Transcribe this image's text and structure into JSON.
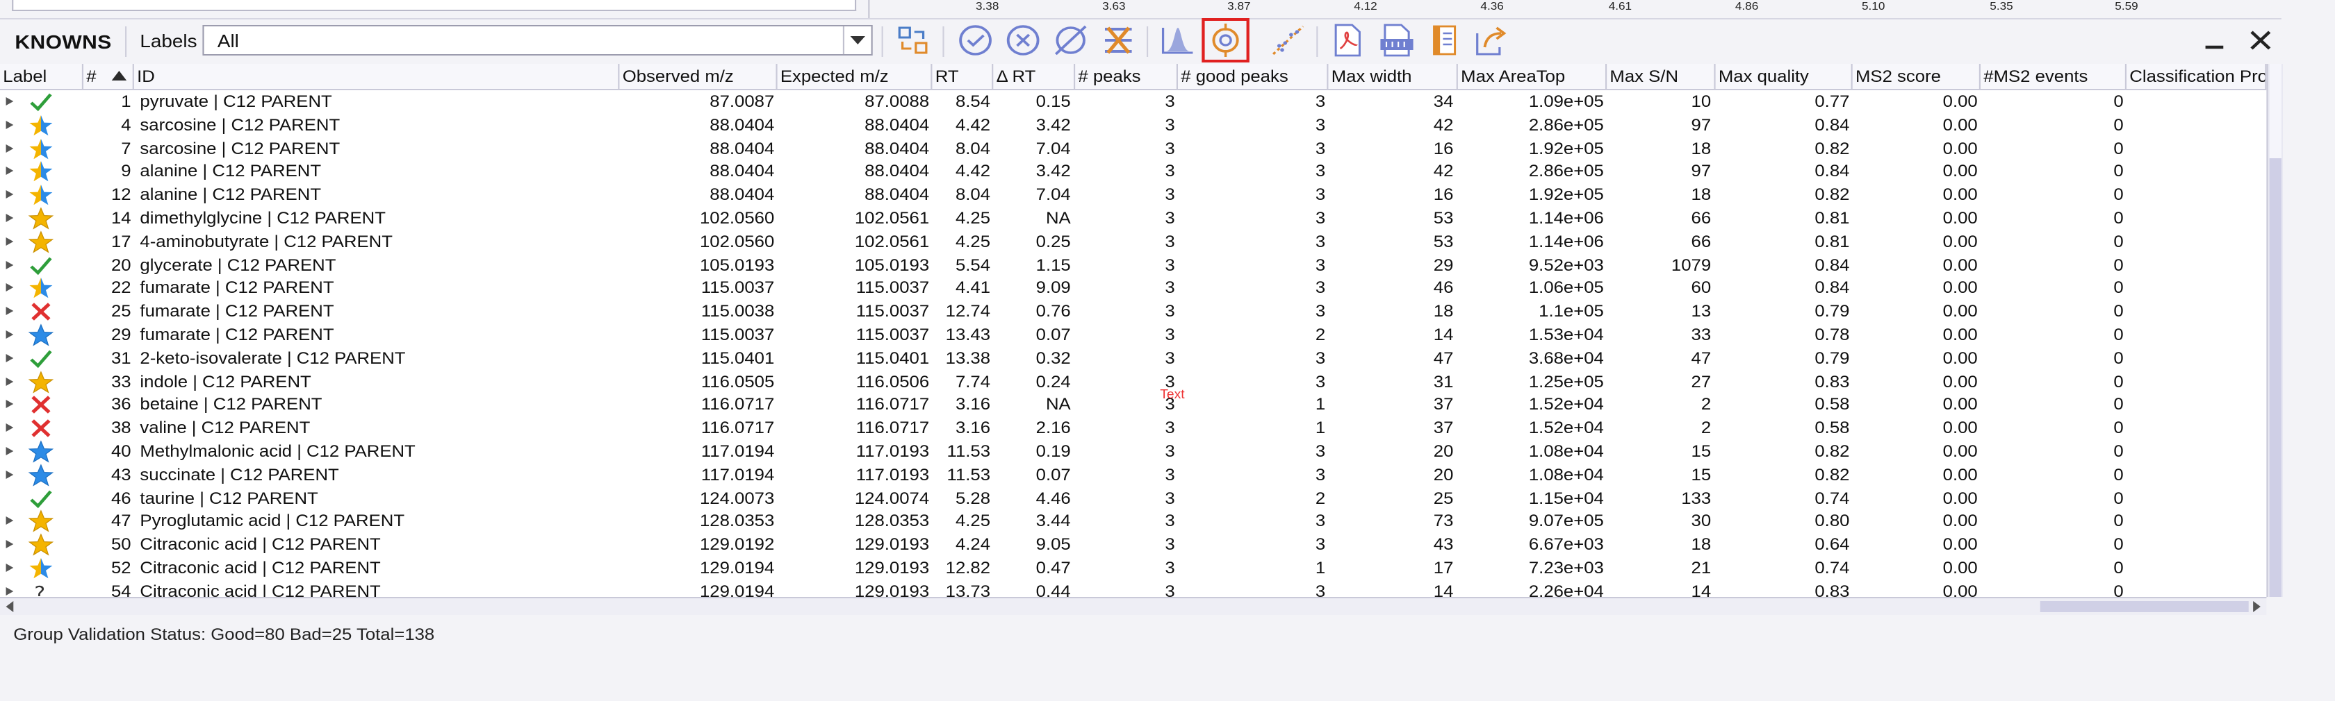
{
  "top_axis_ticks": [
    "3.38",
    "3.63",
    "3.87",
    "4.12",
    "4.36",
    "4.61",
    "4.86",
    "5.10",
    "5.35",
    "5.59"
  ],
  "toolbar": {
    "title": "KNOWNS",
    "labels_caption": "Labels",
    "labels_value": "All"
  },
  "columns": [
    "Label",
    "#",
    "ID",
    "Observed m/z",
    "Expected m/z",
    "RT",
    "Δ RT",
    "# peaks",
    "# good peaks",
    "Max width",
    "Max AreaTop",
    "Max S/N",
    "Max quality",
    "MS2 score",
    "#MS2 events",
    "Classification Pro"
  ],
  "rows": [
    {
      "label": "check",
      "num": "1",
      "id": "pyruvate | C12 PARENT",
      "obs": "87.0087",
      "exp": "87.0088",
      "rt": "8.54",
      "drt": "0.15",
      "peaks": "3",
      "good": "3",
      "width": "34",
      "area": "1.09e+05",
      "sn": "10",
      "quality": "0.77",
      "ms2": "0.00",
      "events": "0"
    },
    {
      "label": "star-blue",
      "num": "4",
      "id": "sarcosine | C12 PARENT",
      "obs": "88.0404",
      "exp": "88.0404",
      "rt": "4.42",
      "drt": "3.42",
      "peaks": "3",
      "good": "3",
      "width": "42",
      "area": "2.86e+05",
      "sn": "97",
      "quality": "0.84",
      "ms2": "0.00",
      "events": "0"
    },
    {
      "label": "star-blue",
      "num": "7",
      "id": "sarcosine | C12 PARENT",
      "obs": "88.0404",
      "exp": "88.0404",
      "rt": "8.04",
      "drt": "7.04",
      "peaks": "3",
      "good": "3",
      "width": "16",
      "area": "1.92e+05",
      "sn": "18",
      "quality": "0.82",
      "ms2": "0.00",
      "events": "0"
    },
    {
      "label": "star-blue",
      "num": "9",
      "id": "alanine | C12 PARENT",
      "obs": "88.0404",
      "exp": "88.0404",
      "rt": "4.42",
      "drt": "3.42",
      "peaks": "3",
      "good": "3",
      "width": "42",
      "area": "2.86e+05",
      "sn": "97",
      "quality": "0.84",
      "ms2": "0.00",
      "events": "0"
    },
    {
      "label": "star-blue",
      "num": "12",
      "id": "alanine | C12 PARENT",
      "obs": "88.0404",
      "exp": "88.0404",
      "rt": "8.04",
      "drt": "7.04",
      "peaks": "3",
      "good": "3",
      "width": "16",
      "area": "1.92e+05",
      "sn": "18",
      "quality": "0.82",
      "ms2": "0.00",
      "events": "0"
    },
    {
      "label": "star-gold",
      "num": "14",
      "id": "dimethylglycine | C12 PARENT",
      "obs": "102.0560",
      "exp": "102.0561",
      "rt": "4.25",
      "drt": "NA",
      "peaks": "3",
      "good": "3",
      "width": "53",
      "area": "1.14e+06",
      "sn": "66",
      "quality": "0.81",
      "ms2": "0.00",
      "events": "0"
    },
    {
      "label": "star-gold",
      "num": "17",
      "id": "4-aminobutyrate | C12 PARENT",
      "obs": "102.0560",
      "exp": "102.0561",
      "rt": "4.25",
      "drt": "0.25",
      "peaks": "3",
      "good": "3",
      "width": "53",
      "area": "1.14e+06",
      "sn": "66",
      "quality": "0.81",
      "ms2": "0.00",
      "events": "0"
    },
    {
      "label": "check",
      "num": "20",
      "id": "glycerate | C12 PARENT",
      "obs": "105.0193",
      "exp": "105.0193",
      "rt": "5.54",
      "drt": "1.15",
      "peaks": "3",
      "good": "3",
      "width": "29",
      "area": "9.52e+03",
      "sn": "1079",
      "quality": "0.84",
      "ms2": "0.00",
      "events": "0"
    },
    {
      "label": "star-blue",
      "num": "22",
      "id": "fumarate | C12 PARENT",
      "obs": "115.0037",
      "exp": "115.0037",
      "rt": "4.41",
      "drt": "9.09",
      "peaks": "3",
      "good": "3",
      "width": "46",
      "area": "1.06e+05",
      "sn": "60",
      "quality": "0.84",
      "ms2": "0.00",
      "events": "0"
    },
    {
      "label": "cross",
      "num": "25",
      "id": "fumarate | C12 PARENT",
      "obs": "115.0038",
      "exp": "115.0037",
      "rt": "12.74",
      "drt": "0.76",
      "peaks": "3",
      "good": "3",
      "width": "18",
      "area": "1.1e+05",
      "sn": "13",
      "quality": "0.79",
      "ms2": "0.00",
      "events": "0"
    },
    {
      "label": "star-blue-full",
      "num": "29",
      "id": "fumarate | C12 PARENT",
      "obs": "115.0037",
      "exp": "115.0037",
      "rt": "13.43",
      "drt": "0.07",
      "peaks": "3",
      "good": "2",
      "width": "14",
      "area": "1.53e+04",
      "sn": "33",
      "quality": "0.78",
      "ms2": "0.00",
      "events": "0"
    },
    {
      "label": "check",
      "num": "31",
      "id": "2-keto-isovalerate | C12 PARENT",
      "obs": "115.0401",
      "exp": "115.0401",
      "rt": "13.38",
      "drt": "0.32",
      "peaks": "3",
      "good": "3",
      "width": "47",
      "area": "3.68e+04",
      "sn": "47",
      "quality": "0.79",
      "ms2": "0.00",
      "events": "0"
    },
    {
      "label": "star-gold",
      "num": "33",
      "id": "indole | C12 PARENT",
      "obs": "116.0505",
      "exp": "116.0506",
      "rt": "7.74",
      "drt": "0.24",
      "peaks": "3",
      "good": "3",
      "width": "31",
      "area": "1.25e+05",
      "sn": "27",
      "quality": "0.83",
      "ms2": "0.00",
      "events": "0"
    },
    {
      "label": "cross",
      "num": "36",
      "id": "betaine | C12 PARENT",
      "obs": "116.0717",
      "exp": "116.0717",
      "rt": "3.16",
      "drt": "NA",
      "peaks": "3",
      "good": "1",
      "width": "37",
      "area": "1.52e+04",
      "sn": "2",
      "quality": "0.58",
      "ms2": "0.00",
      "events": "0"
    },
    {
      "label": "cross",
      "num": "38",
      "id": "valine | C12 PARENT",
      "obs": "116.0717",
      "exp": "116.0717",
      "rt": "3.16",
      "drt": "2.16",
      "peaks": "3",
      "good": "1",
      "width": "37",
      "area": "1.52e+04",
      "sn": "2",
      "quality": "0.58",
      "ms2": "0.00",
      "events": "0"
    },
    {
      "label": "star-blue-full",
      "num": "40",
      "id": "Methylmalonic acid | C12 PARENT",
      "obs": "117.0194",
      "exp": "117.0193",
      "rt": "11.53",
      "drt": "0.19",
      "peaks": "3",
      "good": "3",
      "width": "20",
      "area": "1.08e+04",
      "sn": "15",
      "quality": "0.82",
      "ms2": "0.00",
      "events": "0"
    },
    {
      "label": "star-blue-full",
      "num": "43",
      "id": "succinate | C12 PARENT",
      "obs": "117.0194",
      "exp": "117.0193",
      "rt": "11.53",
      "drt": "0.07",
      "peaks": "3",
      "good": "3",
      "width": "20",
      "area": "1.08e+04",
      "sn": "15",
      "quality": "0.82",
      "ms2": "0.00",
      "events": "0"
    },
    {
      "label": "check",
      "num": "46",
      "id": "taurine | C12 PARENT",
      "obs": "124.0073",
      "exp": "124.0074",
      "rt": "5.28",
      "drt": "4.46",
      "peaks": "3",
      "good": "2",
      "width": "25",
      "area": "1.15e+04",
      "sn": "133",
      "quality": "0.74",
      "ms2": "0.00",
      "events": "0"
    },
    {
      "label": "star-gold",
      "num": "47",
      "id": "Pyroglutamic acid | C12 PARENT",
      "obs": "128.0353",
      "exp": "128.0353",
      "rt": "4.25",
      "drt": "3.44",
      "peaks": "3",
      "good": "3",
      "width": "73",
      "area": "9.07e+05",
      "sn": "30",
      "quality": "0.80",
      "ms2": "0.00",
      "events": "0"
    },
    {
      "label": "star-gold",
      "num": "50",
      "id": "Citraconic acid | C12 PARENT",
      "obs": "129.0192",
      "exp": "129.0193",
      "rt": "4.24",
      "drt": "9.05",
      "peaks": "3",
      "good": "3",
      "width": "43",
      "area": "6.67e+03",
      "sn": "18",
      "quality": "0.64",
      "ms2": "0.00",
      "events": "0"
    },
    {
      "label": "star-blue",
      "num": "52",
      "id": "Citraconic acid | C12 PARENT",
      "obs": "129.0194",
      "exp": "129.0193",
      "rt": "12.82",
      "drt": "0.47",
      "peaks": "3",
      "good": "1",
      "width": "17",
      "area": "7.23e+03",
      "sn": "21",
      "quality": "0.74",
      "ms2": "0.00",
      "events": "0"
    },
    {
      "label": "question",
      "num": "54",
      "id": "Citraconic acid | C12 PARENT",
      "obs": "129.0194",
      "exp": "129.0193",
      "rt": "13.73",
      "drt": "0.44",
      "peaks": "3",
      "good": "3",
      "width": "14",
      "area": "2.26e+04",
      "sn": "14",
      "quality": "0.83",
      "ms2": "0.00",
      "events": "0"
    }
  ],
  "annotation_text": "Text",
  "status_text": "Group Validation Status: Good=80 Bad=25 Total=138",
  "colors": {
    "check": "#2e9e3a",
    "cross": "#e03030",
    "star_gold": "#f4b400",
    "star_blue": "#2c8be6",
    "highlight": "#e02020"
  }
}
